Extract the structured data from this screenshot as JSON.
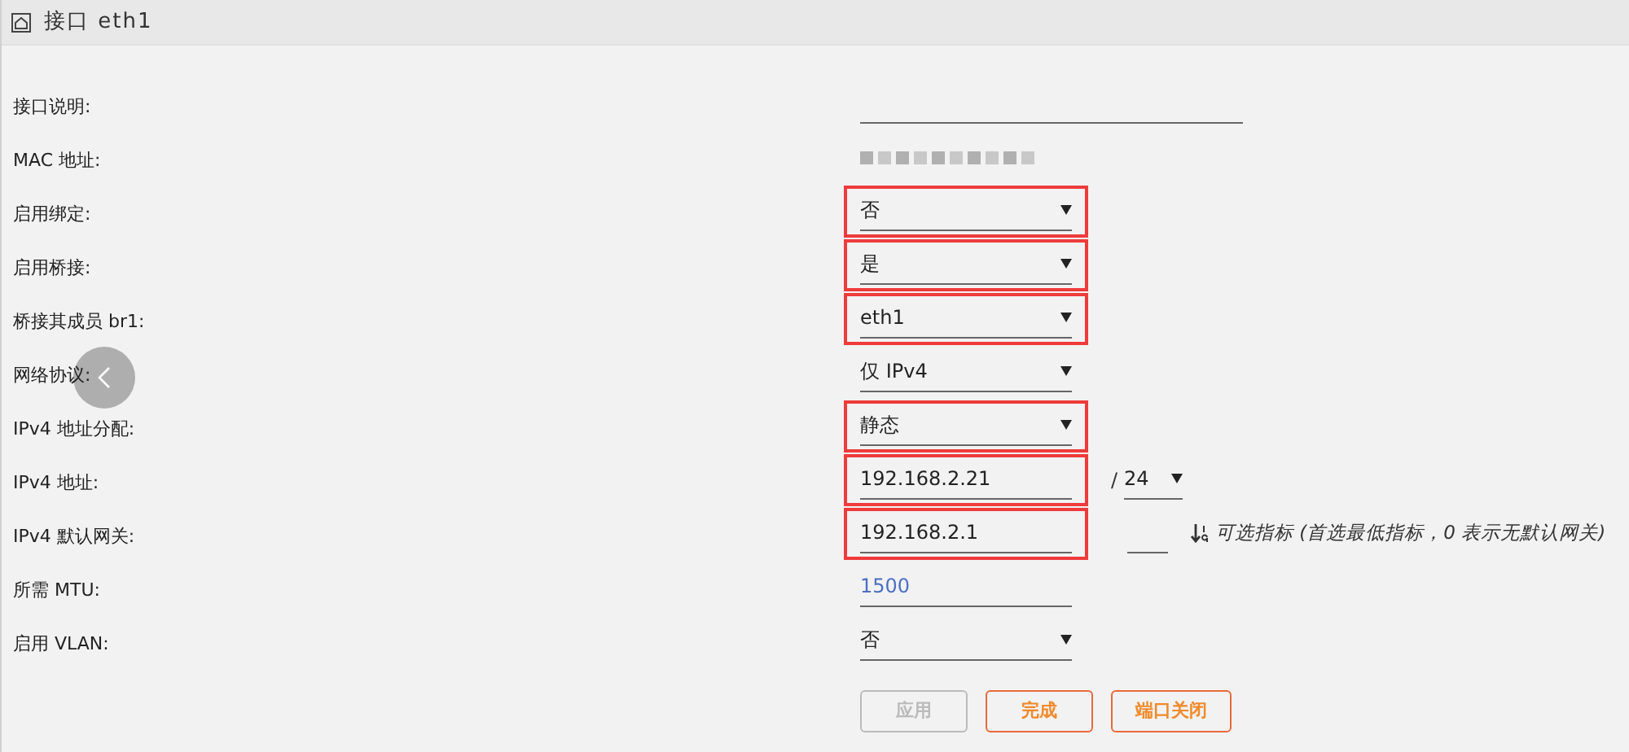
{
  "header": {
    "title": "接口 eth1"
  },
  "rows": [
    {
      "label": "接口说明:",
      "kind": "input",
      "highlighted": false
    },
    {
      "label": "MAC 地址:",
      "kind": "masked"
    },
    {
      "label": "启用绑定:",
      "kind": "select",
      "value": "否",
      "highlighted": true
    },
    {
      "label": "启用桥接:",
      "kind": "select",
      "value": "是",
      "highlighted": true
    },
    {
      "label": "桥接其成员 br1:",
      "kind": "select",
      "value": "eth1",
      "highlighted": true
    },
    {
      "label": "网络协议:",
      "kind": "select",
      "value": "仅 IPv4",
      "highlighted": false
    },
    {
      "label": "IPv4 地址分配:",
      "kind": "select",
      "value": "静态",
      "highlighted": true
    },
    {
      "label": "IPv4 地址:",
      "kind": "input",
      "value": "192.168.2.21",
      "highlighted": true,
      "prefix": {
        "separator": "/",
        "value": "24"
      }
    },
    {
      "label": "IPv4 默认网关:",
      "kind": "input",
      "value": "192.168.2.1",
      "highlighted": true,
      "metric": {
        "hint": "可选指标 (首选最低指标，0 表示无默认网关)"
      }
    },
    {
      "label": "所需 MTU:",
      "kind": "input",
      "placeholder": "1500",
      "highlighted": false
    },
    {
      "label": "启用 VLAN:",
      "kind": "select",
      "value": "否",
      "highlighted": false
    }
  ],
  "buttons": [
    {
      "label": "应用",
      "disabled": true
    },
    {
      "label": "完成",
      "disabled": false
    },
    {
      "label": "端口关闭",
      "disabled": false
    }
  ]
}
